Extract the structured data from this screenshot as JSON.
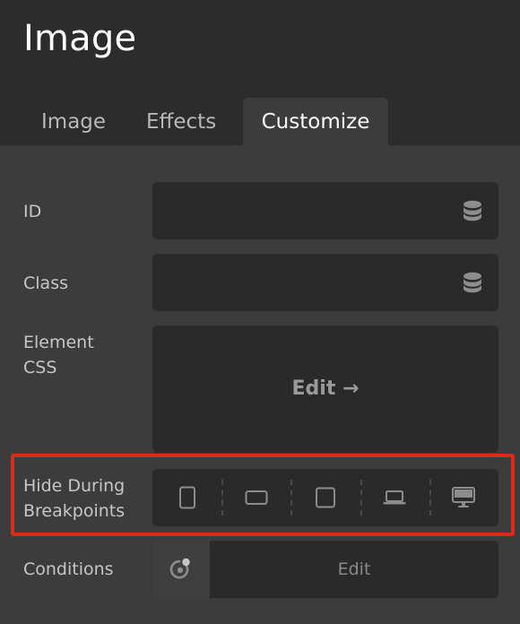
{
  "panel": {
    "title": "Image"
  },
  "tabs": [
    {
      "label": "Image",
      "active": false
    },
    {
      "label": "Effects",
      "active": false
    },
    {
      "label": "Customize",
      "active": true
    }
  ],
  "fields": {
    "id": {
      "label": "ID",
      "value": "",
      "icon": "database-icon"
    },
    "class": {
      "label": "Class",
      "value": "",
      "icon": "database-icon"
    },
    "element_css": {
      "label_line1": "Element",
      "label_line2": "CSS",
      "button": "Edit →"
    },
    "hide_breakpoints": {
      "label_line1": "Hide During",
      "label_line2": "Breakpoints",
      "devices": [
        "phone-portrait-icon",
        "phone-landscape-icon",
        "tablet-icon",
        "laptop-icon",
        "desktop-icon"
      ]
    },
    "conditions": {
      "label": "Conditions",
      "button": "Edit",
      "icon": "conditions-icon"
    }
  },
  "colors": {
    "highlight": "#d92d1a",
    "background": "#3c3c3c",
    "field": "#2a2a2a"
  }
}
